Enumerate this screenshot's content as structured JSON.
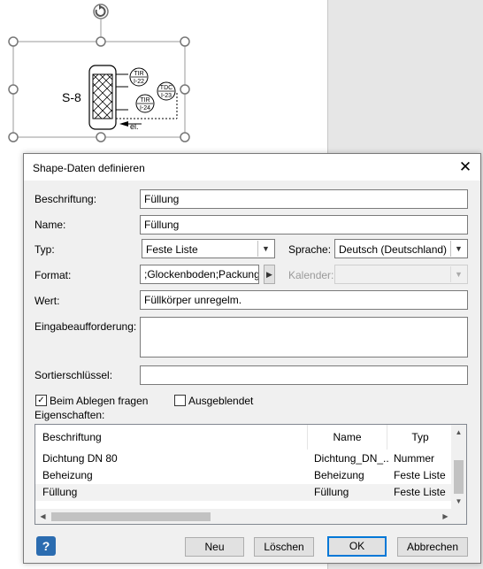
{
  "shape": {
    "label": "S-8",
    "instruments": [
      {
        "top": "TIR",
        "bottom": "I-22"
      },
      {
        "top": "TDC",
        "bottom": "I-23"
      },
      {
        "top": "TIR",
        "bottom": "I-24"
      }
    ],
    "power_label": "el."
  },
  "dialog": {
    "title": "Shape-Daten definieren",
    "close_label": "✕",
    "fields": {
      "beschriftung_label": "Beschriftung:",
      "beschriftung_value": "Füllung",
      "name_label": "Name:",
      "name_value": "Füllung",
      "typ_label": "Typ:",
      "typ_value": "Feste Liste",
      "sprache_label": "Sprache:",
      "sprache_value": "Deutsch (Deutschland)",
      "format_label": "Format:",
      "format_value": ";Glockenboden;Packung",
      "kalender_label": "Kalender:",
      "kalender_value": "",
      "wert_label": "Wert:",
      "wert_value": "Füllkörper unregelm.",
      "eingabe_label": "Eingabeaufforderung:",
      "eingabe_value": "",
      "sortier_label": "Sortierschlüssel:",
      "sortier_value": ""
    },
    "checkboxes": {
      "ablegen_label": "Beim Ablegen fragen",
      "ablegen_checked": true,
      "ausgeblendet_label": "Ausgeblendet",
      "ausgeblendet_checked": false
    },
    "properties": {
      "label": "Eigenschaften:",
      "columns": [
        "Beschriftung",
        "Name",
        "Typ"
      ],
      "rows": [
        {
          "caption": "Dichtung DN 80",
          "name": "Dichtung_DN_...",
          "type": "Nummer"
        },
        {
          "caption": "Beheizung",
          "name": "Beheizung",
          "type": "Feste Liste"
        },
        {
          "caption": "Füllung",
          "name": "Füllung",
          "type": "Feste Liste"
        }
      ]
    },
    "buttons": {
      "help": "?",
      "new": "Neu",
      "delete": "Löschen",
      "ok": "OK",
      "cancel": "Abbrechen"
    }
  }
}
